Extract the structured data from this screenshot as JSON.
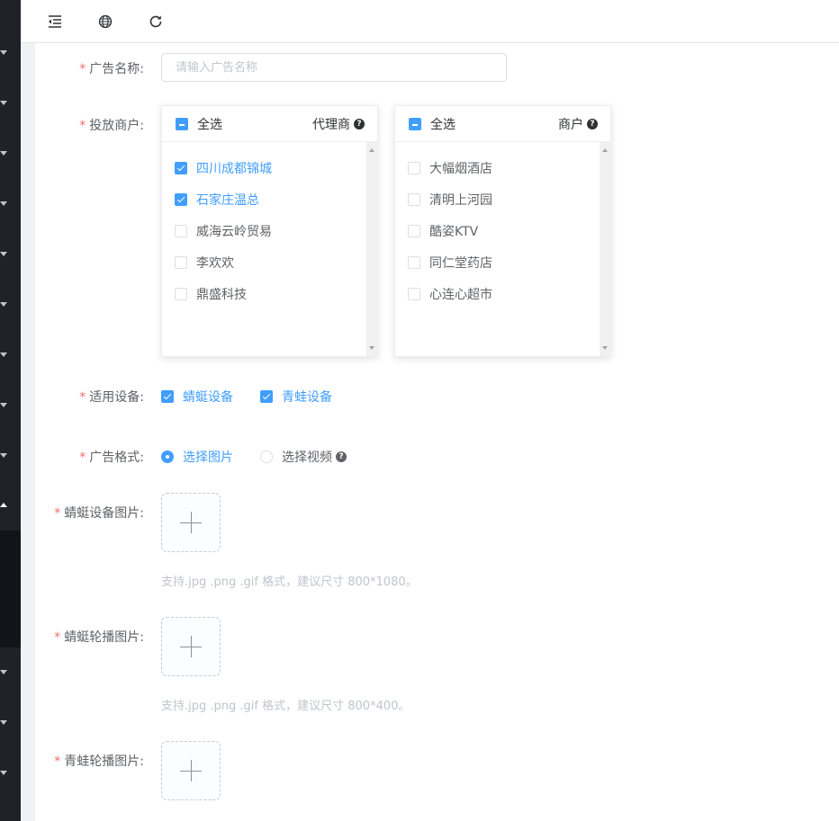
{
  "toolbar": {
    "icons": [
      "menu-fold-icon",
      "globe-icon",
      "refresh-icon"
    ]
  },
  "form": {
    "ad_name": {
      "label": "广告名称:",
      "placeholder": "请输入广告名称"
    },
    "merchants": {
      "label": "投放商户:",
      "agent_panel": {
        "select_all": "全选",
        "title": "代理商",
        "items": [
          {
            "label": "四川成都锦城",
            "checked": true
          },
          {
            "label": "石家庄温总",
            "checked": true
          },
          {
            "label": "威海云岭贸易",
            "checked": false
          },
          {
            "label": "李欢欢",
            "checked": false
          },
          {
            "label": "鼎盛科技",
            "checked": false
          }
        ]
      },
      "shop_panel": {
        "select_all": "全选",
        "title": "商户",
        "items": [
          {
            "label": "大幅烟酒店",
            "checked": false
          },
          {
            "label": "清明上河园",
            "checked": false
          },
          {
            "label": "酷姿KTV",
            "checked": false
          },
          {
            "label": "同仁堂药店",
            "checked": false
          },
          {
            "label": "心连心超市",
            "checked": false
          }
        ]
      }
    },
    "devices": {
      "label": "适用设备:",
      "options": [
        {
          "label": "蜻蜓设备",
          "checked": true
        },
        {
          "label": "青蛙设备",
          "checked": true
        }
      ]
    },
    "format": {
      "label": "广告格式:",
      "options": [
        {
          "label": "选择图片",
          "selected": true
        },
        {
          "label": "选择视频",
          "selected": false
        }
      ]
    },
    "dragonfly_image": {
      "label": "蜻蜓设备图片:",
      "tip": "支持.jpg .png .gif 格式，建议尺寸 800*1080。"
    },
    "dragonfly_carousel": {
      "label": "蜻蜓轮播图片:",
      "tip": "支持.jpg .png .gif 格式，建议尺寸 800*400。"
    },
    "frog_carousel": {
      "label": "青蛙轮播图片:"
    },
    "required_mark": "*"
  },
  "colors": {
    "primary": "#409eff",
    "required": "#f56c6c",
    "sidebar": "#1f2329"
  }
}
